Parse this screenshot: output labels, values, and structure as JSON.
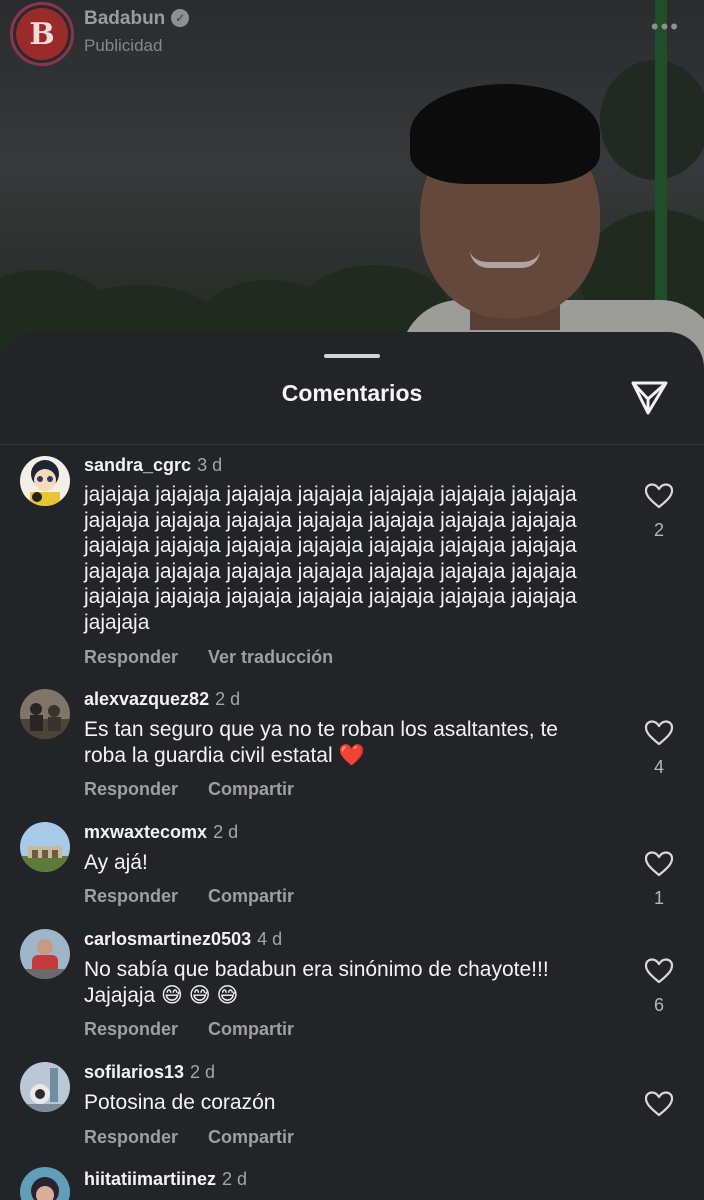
{
  "post_header": {
    "account_name": "Badabun",
    "logo_letter": "B",
    "subtitle": "Publicidad",
    "more_icon": "more-horizontal-icon"
  },
  "sheet": {
    "title": "Comentarios",
    "send_icon": "send-icon"
  },
  "comments": [
    {
      "username": "sandra_cgrc",
      "time": "3 d",
      "lines": [
        "jajajaja jajajaja jajajaja jajajaja jajajaja jajajaja jajajaja",
        "jajajaja jajajaja jajajaja jajajaja jajajaja jajajaja jajajaja",
        "jajajaja jajajaja jajajaja jajajaja jajajaja jajajaja jajajaja",
        "jajajaja jajajaja jajajaja jajajaja jajajaja jajajaja jajajaja",
        "jajajaja jajajaja jajajaja jajajaja jajajaja jajajaja jajajaja",
        "jajajaja"
      ],
      "actions": [
        "Responder",
        "Ver traducción"
      ],
      "likes": "2"
    },
    {
      "username": "alexvazquez82",
      "time": "2 d",
      "lines": [
        "Es tan seguro que ya no te roban los asaltantes, te",
        "roba la guardia civil estatal ❤️"
      ],
      "actions": [
        "Responder",
        "Compartir"
      ],
      "likes": "4"
    },
    {
      "username": "mxwaxtecomx",
      "time": "2 d",
      "lines": [
        "Ay ajá!"
      ],
      "actions": [
        "Responder",
        "Compartir"
      ],
      "likes": "1"
    },
    {
      "username": "carlosmartinez0503",
      "time": "4 d",
      "lines": [
        "No sabía que badabun era sinónimo de chayote!!!",
        "Jajajaja 😅 😅 😅"
      ],
      "actions": [
        "Responder",
        "Compartir"
      ],
      "likes": "6"
    },
    {
      "username": "sofilarios13",
      "time": "2 d",
      "lines": [
        "Potosina de corazón"
      ],
      "actions": [
        "Responder",
        "Compartir"
      ],
      "likes": ""
    },
    {
      "username": "hiitatiimartiinez",
      "time": "2 d",
      "lines": [],
      "actions": [],
      "likes": ""
    }
  ],
  "colors": {
    "sheet_bg": "#232427",
    "heart_outline": "#d9d9d9",
    "secondary_text": "#9d9fa3"
  }
}
